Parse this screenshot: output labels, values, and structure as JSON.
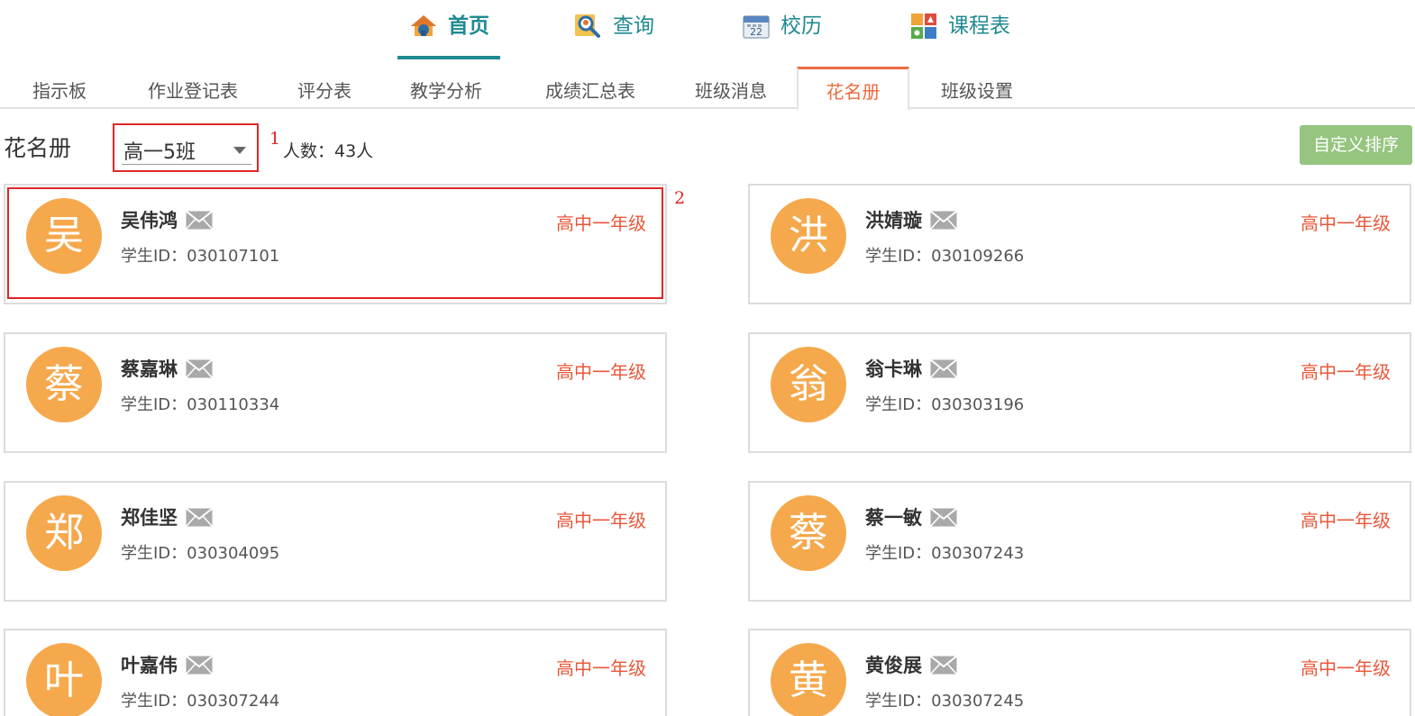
{
  "topnav": [
    {
      "label": "首页",
      "icon": "home-icon",
      "active": true
    },
    {
      "label": "查询",
      "icon": "search-icon",
      "active": false
    },
    {
      "label": "校历",
      "icon": "calendar-icon",
      "active": false
    },
    {
      "label": "课程表",
      "icon": "schedule-icon",
      "active": false
    }
  ],
  "subtabs": [
    {
      "label": "指示板"
    },
    {
      "label": "作业登记表"
    },
    {
      "label": "评分表"
    },
    {
      "label": "教学分析"
    },
    {
      "label": "成绩汇总表"
    },
    {
      "label": "班级消息"
    },
    {
      "label": "花名册",
      "active": true
    },
    {
      "label": "班级设置"
    }
  ],
  "toolbar": {
    "title": "花名册",
    "class_select": "高一5班",
    "annotation_1": "1",
    "count": "人数：43人",
    "sort_button": "自定义排序"
  },
  "annotation_2": "2",
  "colors": {
    "accent": "#1f8a91",
    "active_tab": "#ec6a3d",
    "avatar": "#f5a94c",
    "grade": "#e8583a",
    "sort_button": "#95c57e",
    "highlight": "#e02626"
  },
  "students": [
    {
      "initial": "吴",
      "name": "吴伟鸿",
      "id": "学生ID：030107101",
      "grade": "高中一年级"
    },
    {
      "initial": "洪",
      "name": "洪婧璇",
      "id": "学生ID：030109266",
      "grade": "高中一年级"
    },
    {
      "initial": "蔡",
      "name": "蔡嘉琳",
      "id": "学生ID：030110334",
      "grade": "高中一年级"
    },
    {
      "initial": "翁",
      "name": "翁卡琳",
      "id": "学生ID：030303196",
      "grade": "高中一年级"
    },
    {
      "initial": "郑",
      "name": "郑佳坚",
      "id": "学生ID：030304095",
      "grade": "高中一年级"
    },
    {
      "initial": "蔡",
      "name": "蔡一敏",
      "id": "学生ID：030307243",
      "grade": "高中一年级"
    },
    {
      "initial": "叶",
      "name": "叶嘉伟",
      "id": "学生ID：030307244",
      "grade": "高中一年级"
    },
    {
      "initial": "黄",
      "name": "黄俊展",
      "id": "学生ID：030307245",
      "grade": "高中一年级"
    }
  ]
}
